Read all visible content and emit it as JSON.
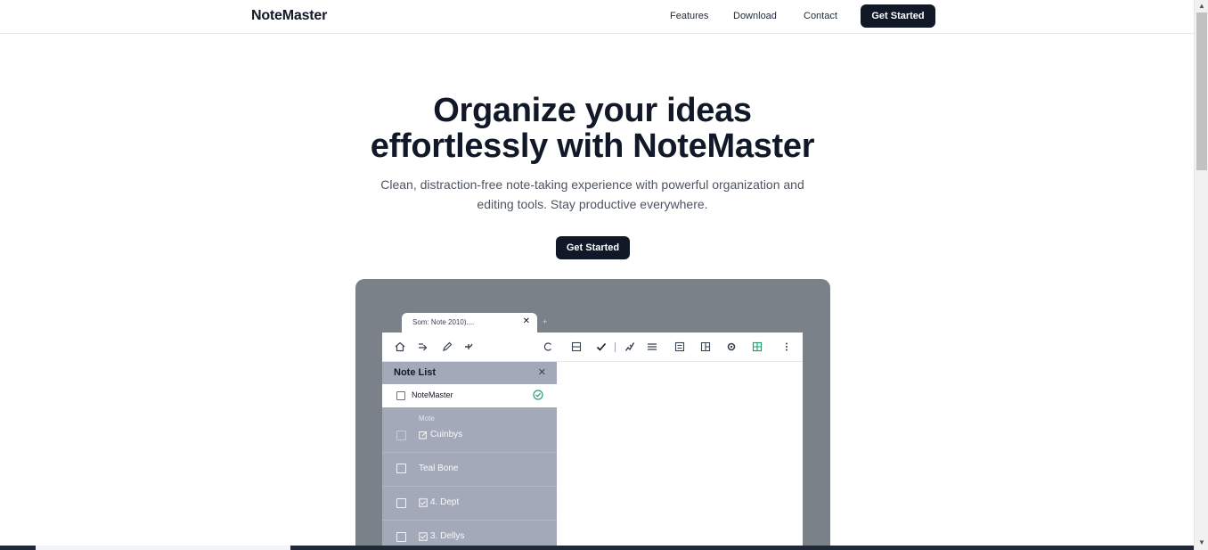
{
  "nav": {
    "brand": "NoteMaster",
    "links": [
      "Features",
      "Download",
      "Contact"
    ],
    "cta": "Get Started"
  },
  "hero": {
    "title_line1": "Organize your ideas",
    "title_line2": "effortlessly with NoteMaster",
    "subtitle_line1": "Clean, distraction-free note-taking experience with powerful organization and",
    "subtitle_line2": "editing tools. Stay productive everywhere.",
    "cta": "Get Started"
  },
  "preview": {
    "tab_label": "Som: Note 2010)....",
    "tab_close": "✕",
    "tab_add": "+",
    "panel": {
      "title": "Note List",
      "close": "✕",
      "selected_note": "NoteMaster",
      "group_label": "Mote",
      "notes": [
        "Cuinbys",
        "Teal Bone",
        "4. Dept",
        "3. Dellys"
      ]
    },
    "toolbar_icons": [
      "home-icon",
      "redo-icon",
      "pencil-icon",
      "share-icon",
      "refresh-icon",
      "save-icon",
      "check-icon",
      "brush-icon",
      "align-icon",
      "image-icon",
      "layout-icon",
      "settings-icon",
      "table-icon",
      "more-icon"
    ]
  },
  "colors": {
    "dark": "#111827",
    "preview_bg": "#7b8189",
    "panel_bg": "#a3a9b9",
    "success": "#22a06b"
  }
}
